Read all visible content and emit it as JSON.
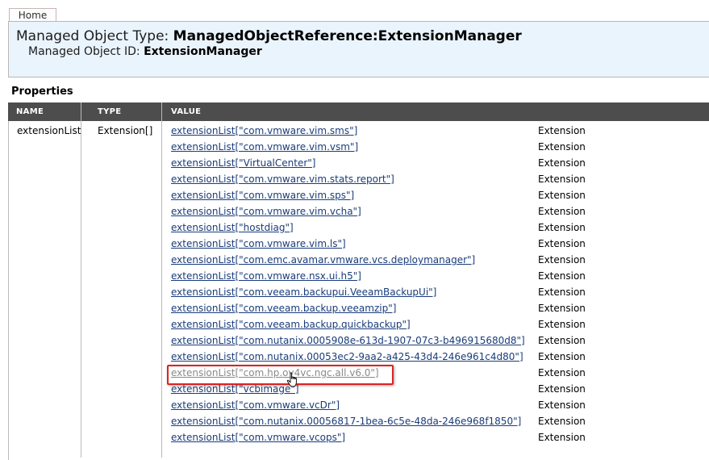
{
  "nav": {
    "home_label": "Home"
  },
  "header": {
    "type_label": "Managed Object Type: ",
    "type_value": "ManagedObjectReference:ExtensionManager",
    "id_label": "Managed Object ID: ",
    "id_value": "ExtensionManager"
  },
  "properties": {
    "heading": "Properties",
    "columns": {
      "name": "NAME",
      "type": "TYPE",
      "value": "VALUE"
    },
    "row": {
      "name": "extensionList",
      "type": "Extension[]"
    },
    "items": [
      {
        "link": "extensionList[\"com.vmware.vim.sms\"]",
        "type": "Extension"
      },
      {
        "link": "extensionList[\"com.vmware.vim.vsm\"]",
        "type": "Extension"
      },
      {
        "link": "extensionList[\"VirtualCenter\"]",
        "type": "Extension"
      },
      {
        "link": "extensionList[\"com.vmware.vim.stats.report\"]",
        "type": "Extension"
      },
      {
        "link": "extensionList[\"com.vmware.vim.sps\"]",
        "type": "Extension"
      },
      {
        "link": "extensionList[\"com.vmware.vim.vcha\"]",
        "type": "Extension"
      },
      {
        "link": "extensionList[\"hostdiag\"]",
        "type": "Extension"
      },
      {
        "link": "extensionList[\"com.vmware.vim.ls\"]",
        "type": "Extension"
      },
      {
        "link": "extensionList[\"com.emc.avamar.vmware.vcs.deploymanager\"]",
        "type": "Extension"
      },
      {
        "link": "extensionList[\"com.vmware.nsx.ui.h5\"]",
        "type": "Extension"
      },
      {
        "link": "extensionList[\"com.veeam.backupui.VeeamBackupUi\"]",
        "type": "Extension"
      },
      {
        "link": "extensionList[\"com.veeam.backup.veeamzip\"]",
        "type": "Extension"
      },
      {
        "link": "extensionList[\"com.veeam.backup.quickbackup\"]",
        "type": "Extension"
      },
      {
        "link": "extensionList[\"com.nutanix.0005908e-613d-1907-07c3-b496915680d8\"]",
        "type": "Extension"
      },
      {
        "link": "extensionList[\"com.nutanix.00053ec2-9aa2-a425-43d4-246e961c4d80\"]",
        "type": "Extension"
      },
      {
        "link": "extensionList[\"com.hp.ov4vc.ngc.all.v6.0\"]",
        "type": "Extension",
        "state": "highlighted"
      },
      {
        "link": "extensionList[\"vcbimage\"]",
        "type": "Extension"
      },
      {
        "link": "extensionList[\"com.vmware.vcDr\"]",
        "type": "Extension"
      },
      {
        "link": "extensionList[\"com.nutanix.00056817-1bea-6c5e-48da-246e968f1850\"]",
        "type": "Extension"
      },
      {
        "link": "extensionList[\"com.vmware.vcops\"]",
        "type": "Extension"
      }
    ]
  }
}
